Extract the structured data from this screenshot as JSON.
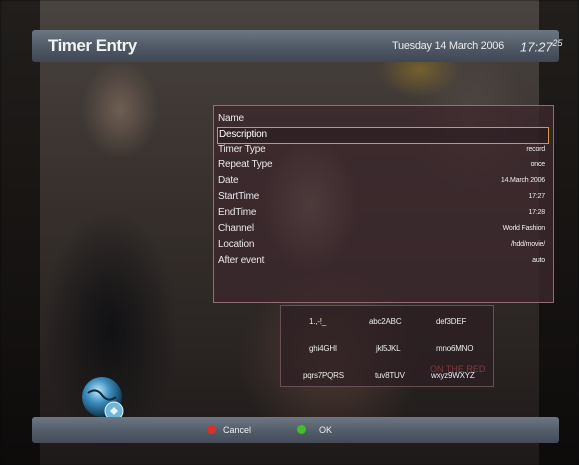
{
  "header": {
    "title": "Timer Entry",
    "date": "Tuesday 14 March 2006",
    "time_hm": "17:27",
    "time_sec": "25"
  },
  "timer": {
    "rows": [
      {
        "label": "Name",
        "value": ""
      },
      {
        "label": "Description",
        "value": ""
      },
      {
        "label": "Timer Type",
        "value": "record"
      },
      {
        "label": "Repeat Type",
        "value": "once"
      },
      {
        "label": "Date",
        "value": "14.March 2006"
      },
      {
        "label": "StartTime",
        "value": "17:27"
      },
      {
        "label": "EndTime",
        "value": "17:28"
      },
      {
        "label": "Channel",
        "value": "World Fashion"
      },
      {
        "label": "Location",
        "value": "/hdd/movie/"
      },
      {
        "label": "After event",
        "value": "auto"
      }
    ],
    "selected_index": 1
  },
  "keypad": {
    "keys": [
      "1.,-!_",
      "abc2ABC",
      "def3DEF",
      "ghi4GHI",
      "jkl5JKL",
      "mno6MNO",
      "pqrs7PQRS",
      "tuv8TUV",
      "wxyz9WXYZ"
    ],
    "overlay": "ON THE RED"
  },
  "footer": {
    "cancel_label": "Cancel",
    "ok_label": "OK",
    "cancel_color": "#d9302a",
    "ok_color": "#3fbf2a"
  }
}
